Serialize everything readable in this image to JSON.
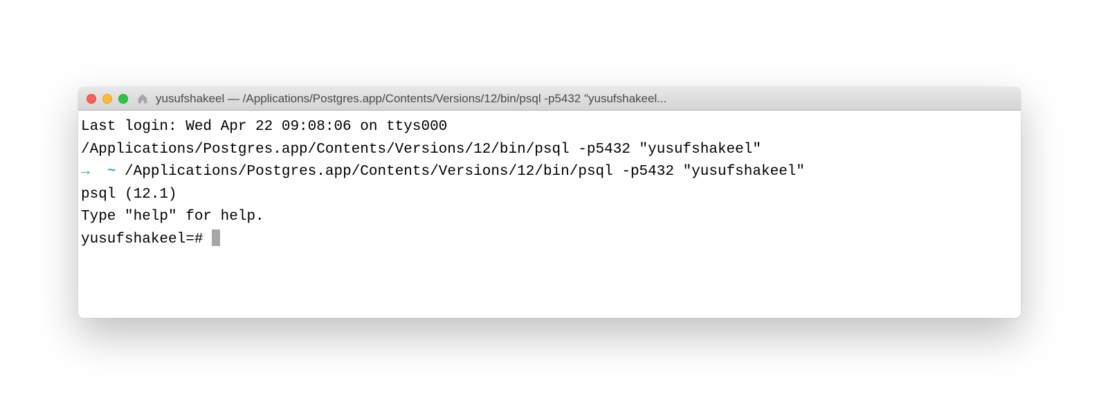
{
  "titlebar": {
    "title": "yusufshakeel — /Applications/Postgres.app/Contents/Versions/12/bin/psql -p5432 \"yusufshakeel..."
  },
  "terminal": {
    "line1": "Last login: Wed Apr 22 09:08:06 on ttys000",
    "line2": "/Applications/Postgres.app/Contents/Versions/12/bin/psql -p5432 \"yusufshakeel\"",
    "prompt_arrow": "→",
    "prompt_tilde": "~",
    "line3_cmd": " /Applications/Postgres.app/Contents/Versions/12/bin/psql -p5432 \"yusufshakeel\"",
    "line4": "psql (12.1)",
    "line5": "Type \"help\" for help.",
    "line_blank": "",
    "prompt_db": "yusufshakeel=# "
  }
}
